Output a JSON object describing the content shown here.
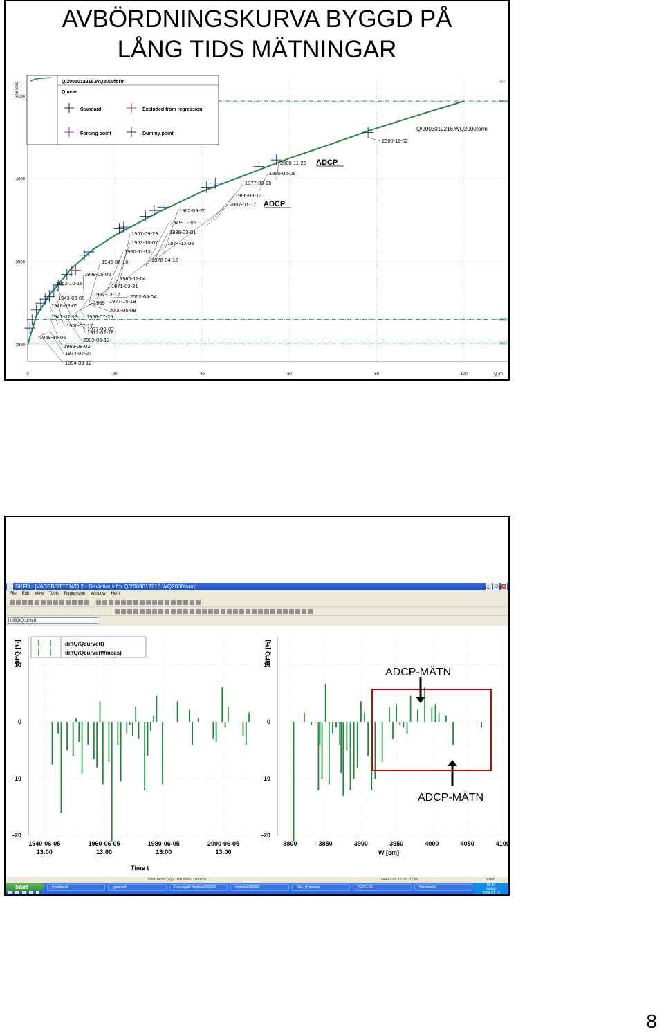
{
  "slide": {
    "title_line1": "AVBÖRDNINGSKURVA BYGGD PÅ",
    "title_line2": "LÅNG TIDS MÄTNINGAR",
    "page_number": "8"
  },
  "rating_curve": {
    "y_axis_label": "W [cm]",
    "x_axis_label": "Q [m",
    "y_ticks": [
      "4100",
      "4000",
      "3900",
      "3800"
    ],
    "x_ticks": [
      "0",
      "20",
      "40",
      "60",
      "80",
      "100"
    ],
    "legend": {
      "curve_name": "Q/2003012216.WQ2000form",
      "section": "Qmeas",
      "items": [
        "Standard",
        "Excluded from regression",
        "Forcing point",
        "Dummy point"
      ]
    },
    "right_edge_labels": [
      "410",
      "4094,0",
      "3830,43",
      "3802"
    ],
    "curve_label": "Q/2003012216.WQ2000form",
    "point_labels": [
      "2000-11-02",
      "2000-11-25",
      "ADCP",
      "1990-02-06",
      "1977-03-25",
      "1966-03-12",
      "2007-01-17",
      "ADCP",
      "1962-09-20",
      "1949-11-05",
      "1957-09-29",
      "1989-03-01",
      "1953-10-07",
      "1974-12-05",
      "1960-11-13",
      "1978-04-12",
      "1945-06-16",
      "1949-05-05",
      "1965-11-04",
      "1952-10-16",
      "1971-03-31",
      "1962-03-12",
      "1943-06-05",
      "2002-04-04",
      "1959",
      "1977-10-19",
      "1946-08-05",
      "2000-05-09",
      "1947-07-13",
      "1958-07-25",
      "1950-07-17",
      "1977-09-03",
      "1972-02-29",
      "1959-10-06",
      "2002-06-12",
      "1969-09-02",
      "1974-07-27",
      "1994-08-12"
    ],
    "chart_data": {
      "type": "line",
      "title": "",
      "xlabel": "Q [m",
      "ylabel": "W [cm]",
      "xlim": [
        0,
        110
      ],
      "ylim": [
        3780,
        4120
      ],
      "grid": true,
      "reference_levels_W": [
        4094,
        3830.43,
        3802
      ],
      "series": [
        {
          "name": "Q/2003012216.WQ2000form",
          "x": [
            0,
            2,
            5,
            10,
            15,
            20,
            30,
            40,
            50,
            60,
            70,
            78,
            90,
            100
          ],
          "y": [
            3800,
            3835,
            3860,
            3892,
            3915,
            3932,
            3960,
            3985,
            4005,
            4025,
            4043,
            4058,
            4078,
            4094
          ]
        },
        {
          "name": "Standard",
          "x": [
            0.5,
            1,
            2,
            3,
            4,
            5,
            6,
            7,
            9,
            10,
            11,
            13,
            14,
            21,
            22,
            27,
            29,
            31,
            41,
            43,
            53,
            57,
            78
          ],
          "y": [
            3820,
            3830,
            3842,
            3850,
            3855,
            3858,
            3865,
            3872,
            3885,
            3889,
            3890,
            3908,
            3912,
            3940,
            3942,
            3955,
            3962,
            3966,
            3990,
            3995,
            4015,
            4023,
            4056
          ]
        }
      ]
    }
  },
  "skfd_window": {
    "title": "SKFD - [VASSBOTTEN/Q:2 - Deviations for Q/2003012216.WQ2000form]",
    "menu": [
      "File",
      "Edit",
      "View",
      "Tools",
      "Regression",
      "Window",
      "Help"
    ],
    "selector_value": "diffQ/Qcurve(t)",
    "legend": [
      "diffQ/Qcurve(t)",
      "diffQ/Qcurve(Wmeas)"
    ],
    "left_plot": {
      "ylabel": "diffQ [%]",
      "xlabel": "Time t",
      "y_ticks": [
        "10",
        "0",
        "-10",
        "-20"
      ],
      "x_ticks": [
        {
          "date": "1940-06-05",
          "time": "13:00"
        },
        {
          "date": "1960-06-05",
          "time": "13:00"
        },
        {
          "date": "1980-06-05",
          "time": "13:00"
        },
        {
          "date": "2000-06-05",
          "time": "13:00"
        }
      ],
      "chart_data": {
        "type": "scatter",
        "xlabel": "Time t",
        "ylabel": "diffQ [%]",
        "ylim": [
          -20,
          15
        ],
        "x": [
          1943,
          1945,
          1946,
          1948,
          1950,
          1951,
          1952,
          1953,
          1955,
          1957,
          1958,
          1959,
          1960,
          1962,
          1963,
          1965,
          1966,
          1968,
          1969,
          1970,
          1971,
          1972,
          1974,
          1975,
          1976,
          1977,
          1978,
          1980,
          1985,
          1989,
          1990,
          1992,
          1997,
          1998,
          2000,
          2001,
          2002,
          2007,
          2008,
          2009
        ],
        "y": [
          -7.5,
          -2,
          -16,
          -5,
          -6,
          0.5,
          -3.5,
          -9,
          -4,
          -6.5,
          -8,
          3.5,
          -11,
          -7,
          -21,
          -4,
          -10.5,
          -2,
          -0.5,
          -2.5,
          2.5,
          -3,
          -12,
          -6,
          -1.5,
          1,
          4.5,
          -11,
          3.5,
          2,
          -4,
          0.5,
          -3,
          -3.5,
          6,
          -1,
          2.5,
          -2.5,
          -4,
          1.5
        ]
      }
    },
    "right_plot": {
      "ylabel": "diffQ [%]",
      "xlabel": "W [cm]",
      "y_ticks": [
        "10",
        "0",
        "-10",
        "-20"
      ],
      "x_ticks": [
        "3800",
        "3850",
        "3900",
        "3950",
        "4000",
        "4050",
        "4100"
      ],
      "chart_data": {
        "type": "scatter",
        "xlabel": "W [cm]",
        "ylabel": "diffQ [%]",
        "ylim": [
          -20,
          15
        ],
        "x": [
          3805,
          3820,
          3830,
          3840,
          3842,
          3845,
          3850,
          3855,
          3860,
          3865,
          3870,
          3872,
          3875,
          3880,
          3885,
          3890,
          3895,
          3900,
          3905,
          3910,
          3915,
          3920,
          3930,
          3940,
          3945,
          3950,
          3955,
          3960,
          3965,
          3970,
          3980,
          3990,
          4000,
          4005,
          4010,
          4020,
          4030,
          4070
        ],
        "y": [
          -21,
          1.5,
          -0.5,
          -12,
          -4,
          -10,
          6.5,
          -11,
          -2,
          -1,
          -4,
          -9,
          -13,
          -5,
          -12,
          -10,
          -8,
          3.5,
          1.5,
          -6,
          -12,
          -10,
          -7,
          2.5,
          -3,
          3,
          -0.5,
          -1,
          -2,
          4.5,
          2,
          6,
          2.5,
          3,
          1.5,
          1,
          -4,
          -1
        ]
      }
    },
    "status": [
      "Zoom factor (x/y) : 100,00% / 100,00%",
      "1994-01-00 12:00 ; 7,009",
      "NUM"
    ],
    "taskbar": {
      "start_label": "Start",
      "tasks": [
        "Hydobs-db",
        "gammalt",
        "Genväg till HydobsDB2003",
        "HydobsDB2003",
        "Obs_Hydrologi",
        "PLPSLAK",
        "Arbetsmiljö"
      ],
      "clock": "08:43",
      "day": "tisdag",
      "date": "2009-01-10"
    }
  },
  "annotations": {
    "adcp_label": "ADCP-MÄTN",
    "adcp_label_bottom": "ADCP-MÄTN",
    "highlight_color": "#d00000",
    "series_color": "#1e8a3c"
  }
}
